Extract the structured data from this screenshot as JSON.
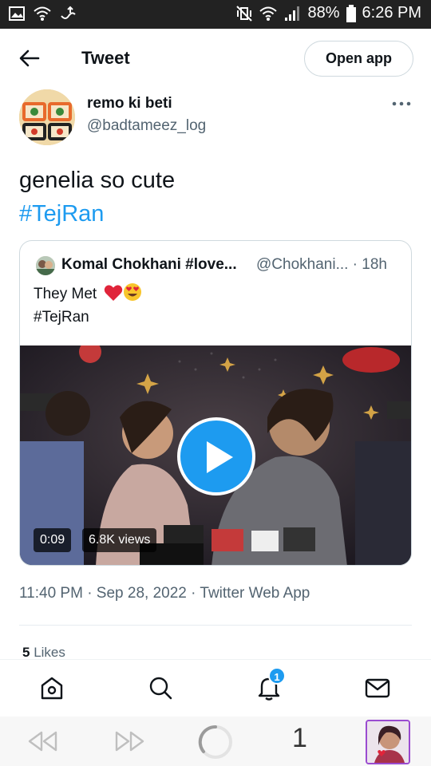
{
  "status_bar": {
    "battery": "88%",
    "time": "6:26 PM"
  },
  "header": {
    "title": "Tweet",
    "open_app": "Open app"
  },
  "author": {
    "name": "remo ki beti",
    "handle": "@badtameez_log"
  },
  "tweet": {
    "text": "genelia so cute",
    "hashtag": "#TejRan",
    "timestamp": "11:40 PM · Sep 28, 2022 · Twitter Web App"
  },
  "quoted": {
    "name": "Komal Chokhani #love...",
    "handle": "@Chokhani... · 18h",
    "text_line1": "They Met",
    "emojis": [
      "red-heart",
      "heart-eyes-face"
    ],
    "hashtag": "#TejRan",
    "video": {
      "duration": "0:09",
      "views": "6.8K views"
    }
  },
  "stats": {
    "likes_count": "5",
    "likes_label": "Likes"
  },
  "bottom_nav": {
    "items": [
      "home-icon",
      "search-icon",
      "notifications-icon",
      "messages-icon"
    ],
    "notification_badge": "1"
  },
  "browser": {
    "tab_count": "1"
  },
  "colors": {
    "accent": "#1d9bf0",
    "text": "#0f1419",
    "secondary": "#536471"
  }
}
